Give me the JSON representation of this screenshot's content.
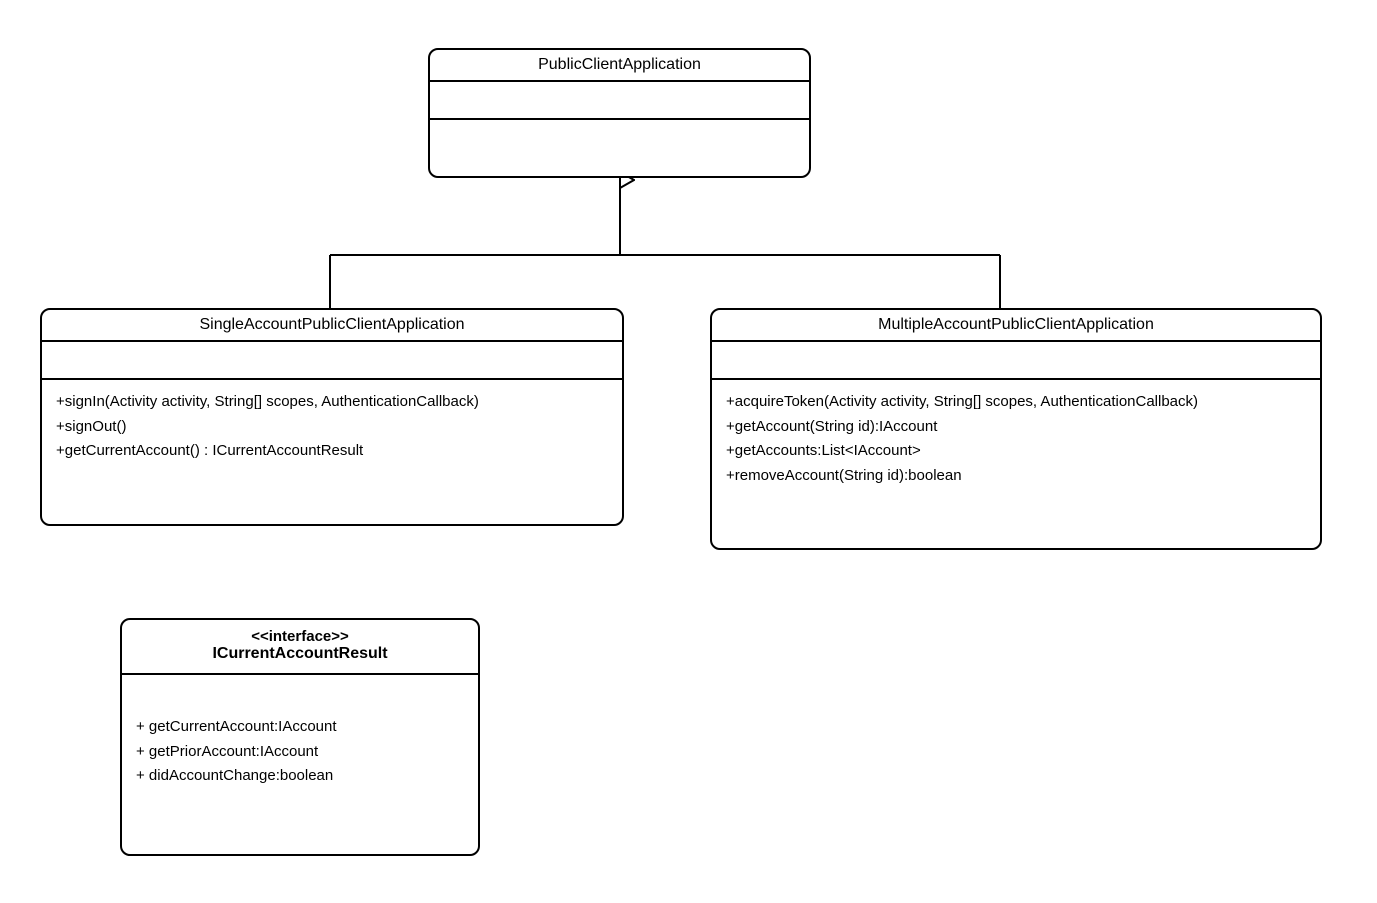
{
  "classes": {
    "parent": {
      "name": "PublicClientApplication"
    },
    "single": {
      "name": "SingleAccountPublicClientApplication",
      "methods": [
        "+signIn(Activity activity, String[] scopes, AuthenticationCallback)",
        "+signOut()",
        "+getCurrentAccount() : ICurrentAccountResult"
      ]
    },
    "multiple": {
      "name": "MultipleAccountPublicClientApplication",
      "methods": [
        "+acquireToken(Activity activity, String[] scopes, AuthenticationCallback)",
        "+getAccount(String id):IAccount",
        "+getAccounts:List<IAccount>",
        "+removeAccount(String id):boolean"
      ]
    },
    "iface": {
      "stereotype": "<<interface>>",
      "name": "ICurrentAccountResult",
      "methods": [
        "+ getCurrentAccount:IAccount",
        "+ getPriorAccount:IAccount",
        "+ didAccountChange:boolean"
      ]
    }
  }
}
